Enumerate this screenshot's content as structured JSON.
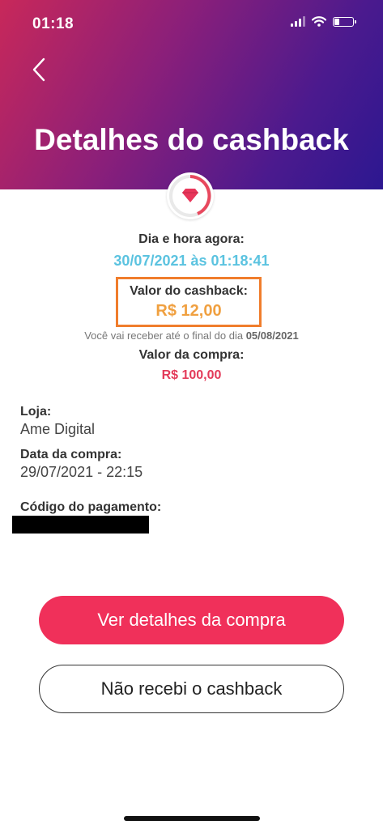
{
  "status_bar": {
    "time": "01:18"
  },
  "header": {
    "title": "Detalhes do cashback",
    "back_icon": "chevron-left-icon"
  },
  "colors": {
    "accent_pink": "#f0305a",
    "cashback_orange": "#f0a040",
    "datetime_blue": "#5bc3e0",
    "purchase_red": "#e33b5a",
    "highlight_border": "#f07d2c"
  },
  "summary": {
    "now_label": "Dia e hora agora:",
    "now_value": "30/07/2021 às 01:18:41",
    "cashback_label": "Valor do cashback:",
    "cashback_value": "R$ 12,00",
    "note_prefix": "Você vai receber até o final do dia",
    "note_date": "05/08/2021",
    "purchase_label": "Valor da compra:",
    "purchase_value": "R$ 100,00"
  },
  "details": {
    "store_label": "Loja:",
    "store_value": "Ame Digital",
    "date_label": "Data da compra:",
    "date_value": "29/07/2021 - 22:15",
    "code_label": "Código do pagamento:"
  },
  "actions": {
    "primary_label": "Ver detalhes da compra",
    "secondary_label": "Não recebi o cashback"
  }
}
